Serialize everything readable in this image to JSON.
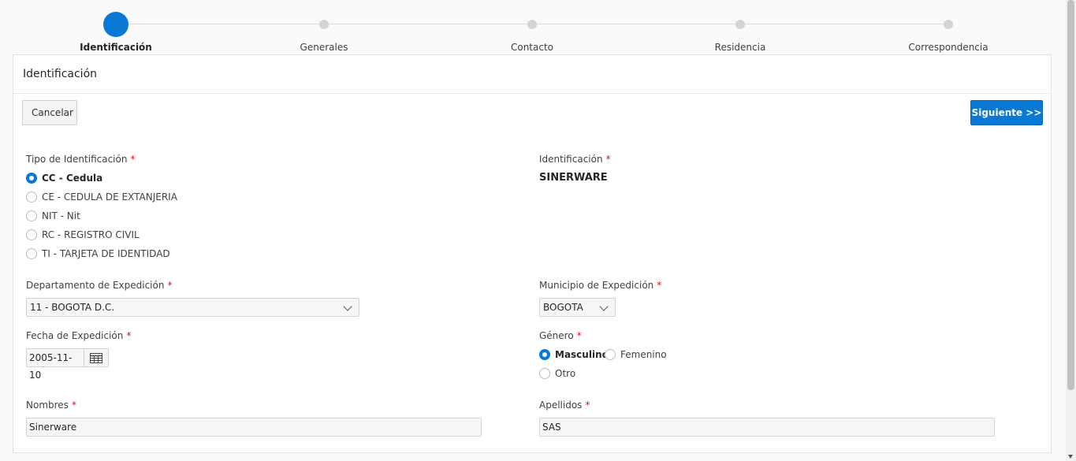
{
  "wizard": {
    "steps": [
      {
        "label": "Identificación",
        "active": true
      },
      {
        "label": "Generales",
        "active": false
      },
      {
        "label": "Contacto",
        "active": false
      },
      {
        "label": "Residencia",
        "active": false
      },
      {
        "label": "Correspondencia",
        "active": false
      }
    ]
  },
  "region": {
    "title": "Identificación",
    "cancel_label": "Cancelar",
    "next_label": "Siguiente >>"
  },
  "form": {
    "tipo_identificacion": {
      "label": "Tipo de Identificación",
      "required_mark": "*",
      "options": [
        {
          "label": "CC - Cedula",
          "checked": true
        },
        {
          "label": "CE - CEDULA DE EXTANJERIA",
          "checked": false
        },
        {
          "label": "NIT - Nit",
          "checked": false
        },
        {
          "label": "RC - REGISTRO CIVIL",
          "checked": false
        },
        {
          "label": "TI - TARJETA DE IDENTIDAD",
          "checked": false
        }
      ]
    },
    "identificacion": {
      "label": "Identificación",
      "required_mark": "*",
      "value": "SINERWARE"
    },
    "departamento": {
      "label": "Departamento de Expedición",
      "required_mark": "*",
      "value": "11 - BOGOTA D.C."
    },
    "municipio": {
      "label": "Municipio de Expedición",
      "required_mark": "*",
      "value": "BOGOTA"
    },
    "fecha": {
      "label": "Fecha de Expedición",
      "required_mark": "*",
      "value": "2005-11-10",
      "icon": "calendar-icon"
    },
    "genero": {
      "label": "Género",
      "required_mark": "*",
      "options": [
        {
          "label": "Masculino",
          "checked": true
        },
        {
          "label": "Femenino",
          "checked": false
        },
        {
          "label": "Otro",
          "checked": false
        }
      ]
    },
    "nombres": {
      "label": "Nombres",
      "required_mark": "*",
      "value": "Sinerware"
    },
    "apellidos": {
      "label": "Apellidos",
      "required_mark": "*",
      "value": "SAS"
    }
  },
  "colors": {
    "accent": "#0a79d6",
    "required": "#d0131b",
    "inactive_step": "#d4d4d4"
  }
}
